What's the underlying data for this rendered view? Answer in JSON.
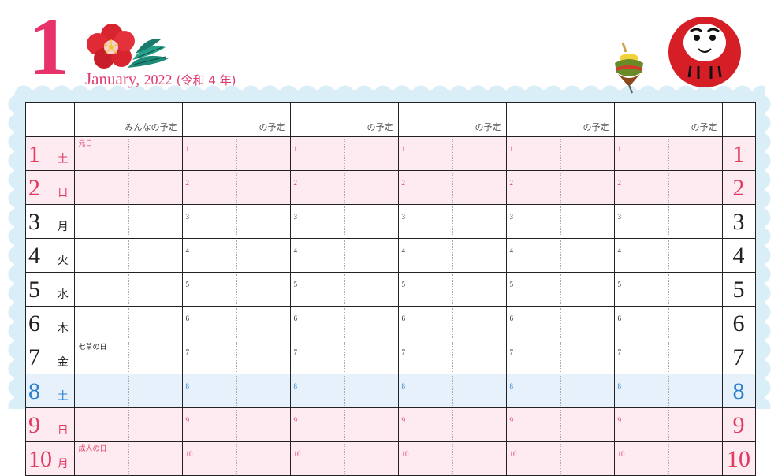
{
  "header": {
    "month_number": "1",
    "month_name": "January,",
    "year": "2022",
    "era": "(令和 4 年)"
  },
  "columns": {
    "everyone": "みんなの予定",
    "person": "の予定"
  },
  "colors": {
    "sunday_holiday_text": "#e23b62",
    "saturday_text": "#2b7fcf",
    "sunday_row_bg": "#fdebf1",
    "saturday_row_bg": "#e6f1fb",
    "frame_blue": "#daeef7"
  },
  "icons": [
    "plum-blossom-icon",
    "pine-branch-icon",
    "spinning-top-icon",
    "daruma-icon"
  ],
  "days": [
    {
      "num": "1",
      "wd": "土",
      "type": "sun",
      "note": "元日"
    },
    {
      "num": "2",
      "wd": "日",
      "type": "sun",
      "note": ""
    },
    {
      "num": "3",
      "wd": "月",
      "type": "weekday",
      "note": ""
    },
    {
      "num": "4",
      "wd": "火",
      "type": "weekday",
      "note": ""
    },
    {
      "num": "5",
      "wd": "水",
      "type": "weekday",
      "note": ""
    },
    {
      "num": "6",
      "wd": "木",
      "type": "weekday",
      "note": ""
    },
    {
      "num": "7",
      "wd": "金",
      "type": "weekday",
      "note": "七草の日"
    },
    {
      "num": "8",
      "wd": "土",
      "type": "sat",
      "note": ""
    },
    {
      "num": "9",
      "wd": "日",
      "type": "sun",
      "note": ""
    },
    {
      "num": "10",
      "wd": "月",
      "type": "sun",
      "note": "成人の日"
    }
  ]
}
